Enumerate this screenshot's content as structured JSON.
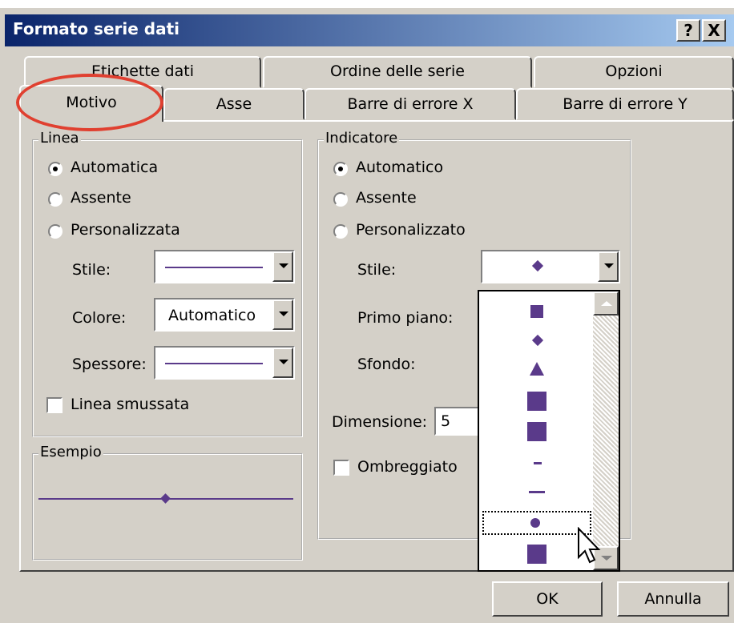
{
  "window": {
    "title": "Formato serie dati",
    "help_label": "?",
    "close_label": "X"
  },
  "tabs": {
    "row1": [
      "Etichette dati",
      "Ordine delle serie",
      "Opzioni"
    ],
    "row2": [
      "Motivo",
      "Asse",
      "Barre di errore X",
      "Barre di errore Y"
    ],
    "active": "Motivo"
  },
  "linea": {
    "group_label": "Linea",
    "automatica": "Automatica",
    "assente": "Assente",
    "personalizzata": "Personalizzata",
    "stile_label": "Stile:",
    "colore_label": "Colore:",
    "colore_value": "Automatico",
    "spessore_label": "Spessore:",
    "smussata_label": "Linea smussata",
    "selected": "automatica"
  },
  "esempio": {
    "group_label": "Esempio"
  },
  "indicatore": {
    "group_label": "Indicatore",
    "automatico": "Automatico",
    "assente": "Assente",
    "personalizzato": "Personalizzato",
    "stile_label": "Stile:",
    "primo_piano_label": "Primo piano:",
    "sfondo_label": "Sfondo:",
    "dimensione_label": "Dimensione:",
    "dimensione_value": "5",
    "ombreggiato_label": "Ombreggiato",
    "selected": "automatico"
  },
  "marker_list": {
    "items": [
      "square",
      "diamond",
      "triangle",
      "square-large",
      "square-large",
      "short-dash",
      "long-dash",
      "circle",
      "square"
    ],
    "selected_index": 7
  },
  "buttons": {
    "ok": "OK",
    "annulla": "Annulla"
  },
  "colors": {
    "accent": "#5a3a8a",
    "annotation": "#e04030"
  }
}
